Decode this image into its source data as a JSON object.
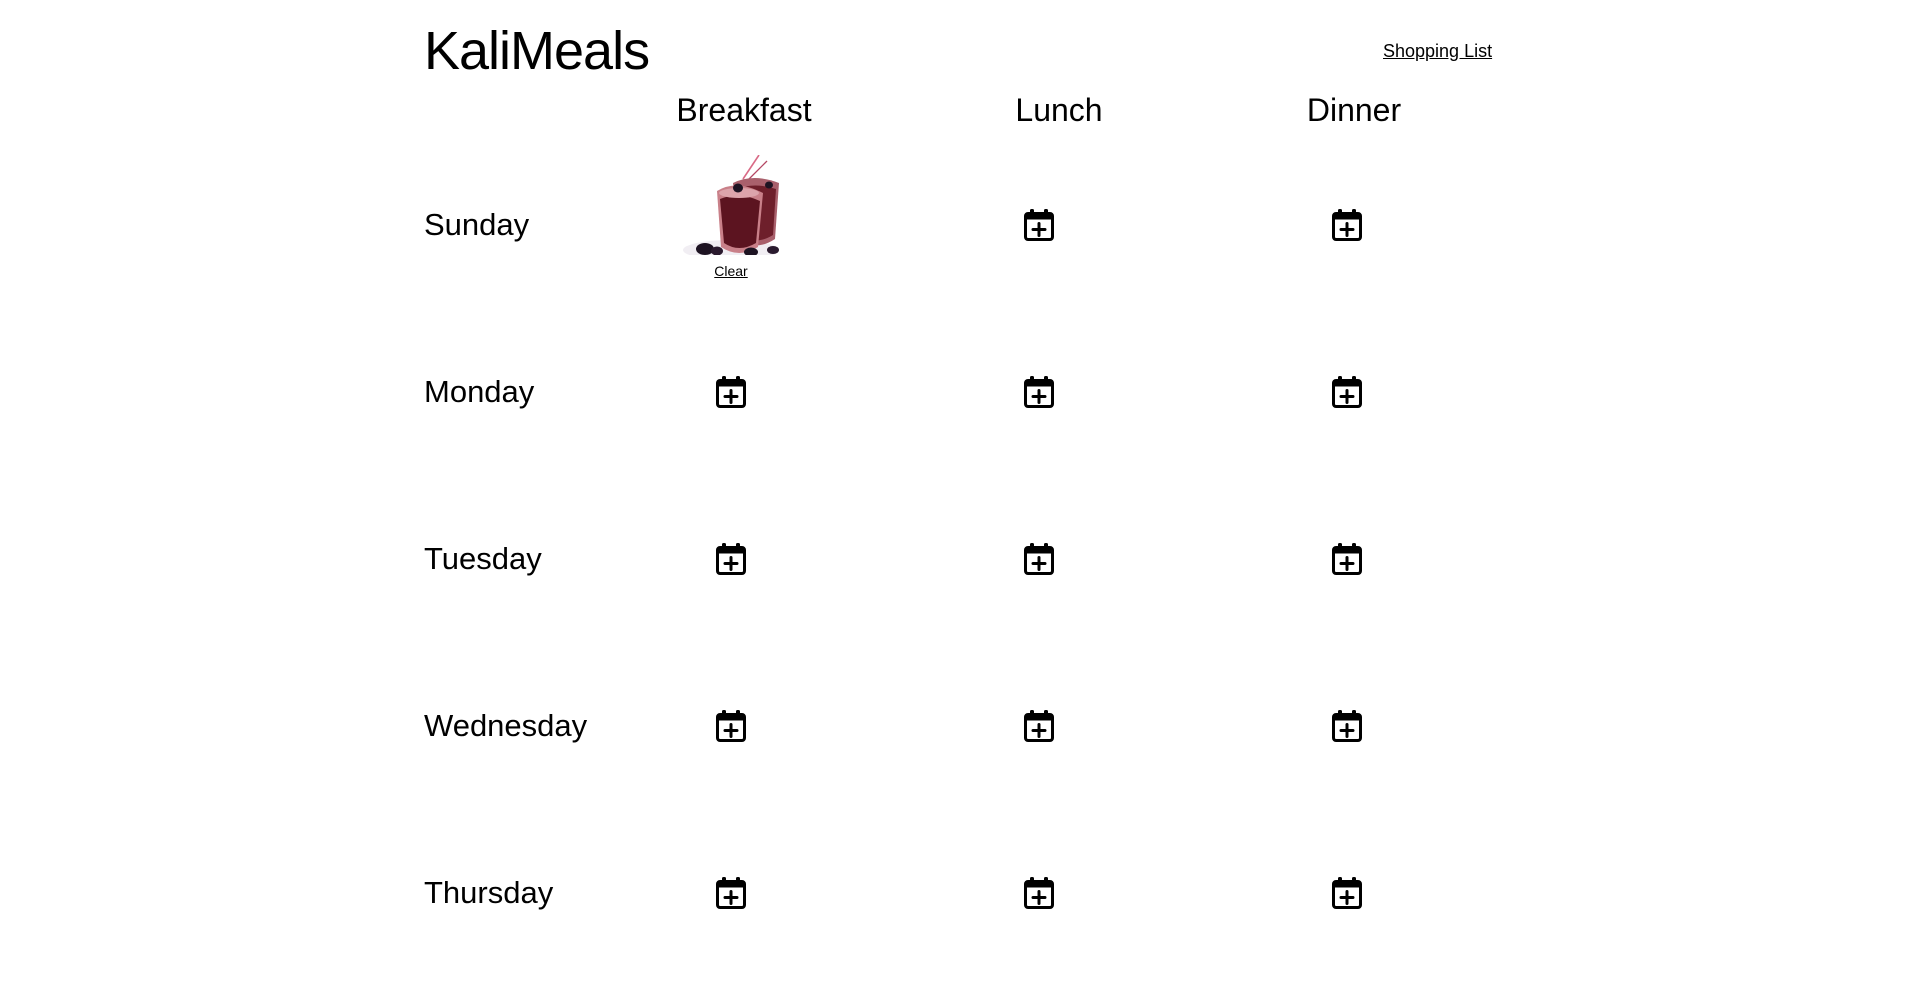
{
  "app": {
    "title": "KaliMeals"
  },
  "nav": {
    "shopping_list_label": "Shopping List"
  },
  "meals": [
    "Breakfast",
    "Lunch",
    "Dinner"
  ],
  "days": [
    "Sunday",
    "Monday",
    "Tuesday",
    "Wednesday",
    "Thursday"
  ],
  "planned": {
    "sunday_breakfast": {
      "image": "berry-smoothie-photo",
      "clear_label": "Clear"
    }
  },
  "icons": {
    "empty_slot": "calendar-plus-icon"
  }
}
